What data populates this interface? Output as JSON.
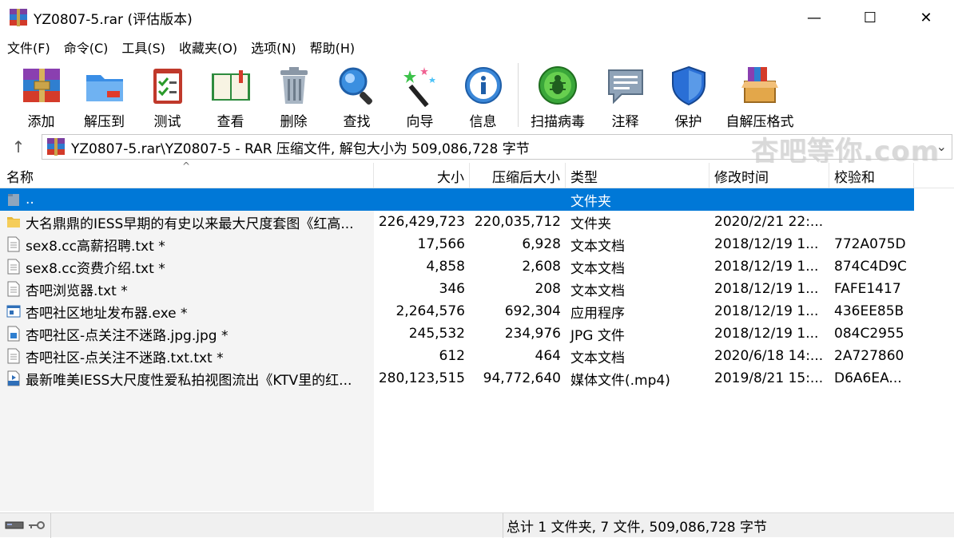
{
  "window": {
    "title": "YZ0807-5.rar (评估版本)",
    "minimize_glyph": "—",
    "maximize_glyph": "☐",
    "close_glyph": "✕"
  },
  "menu": [
    "文件(F)",
    "命令(C)",
    "工具(S)",
    "收藏夹(O)",
    "选项(N)",
    "帮助(H)"
  ],
  "toolbar": {
    "add": "添加",
    "extract_to": "解压到",
    "test": "测试",
    "view": "查看",
    "delete": "删除",
    "find": "查找",
    "wizard": "向导",
    "info": "信息",
    "virus_scan": "扫描病毒",
    "comment": "注释",
    "protect": "保护",
    "sfx": "自解压格式"
  },
  "watermark": "杏吧等你.com",
  "address": {
    "up_glyph": "↑",
    "path": "YZ0807-5.rar\\YZ0807-5 - RAR 压缩文件, 解包大小为 509,086,728 字节",
    "dropdown_glyph": "⌄"
  },
  "columns": {
    "name": "名称",
    "size": "大小",
    "packed": "压缩后大小",
    "type": "类型",
    "modified": "修改时间",
    "crc": "校验和"
  },
  "rows": [
    {
      "icon": "parent-folder-icon",
      "name": "..",
      "size": "",
      "packed": "",
      "type": "文件夹",
      "modified": "",
      "crc": "",
      "selected": true
    },
    {
      "icon": "folder-icon",
      "name": "大名鼎鼎的IESS早期的有史以来最大尺度套图《红高...",
      "size": "226,429,723",
      "packed": "220,035,712",
      "type": "文件夹",
      "modified": "2020/2/21 22:...",
      "crc": ""
    },
    {
      "icon": "text-file-icon",
      "name": "sex8.cc高薪招聘.txt *",
      "size": "17,566",
      "packed": "6,928",
      "type": "文本文档",
      "modified": "2018/12/19 1...",
      "crc": "772A075D"
    },
    {
      "icon": "text-file-icon",
      "name": "sex8.cc资费介绍.txt *",
      "size": "4,858",
      "packed": "2,608",
      "type": "文本文档",
      "modified": "2018/12/19 1...",
      "crc": "874C4D9C"
    },
    {
      "icon": "text-file-icon",
      "name": "杏吧浏览器.txt *",
      "size": "346",
      "packed": "208",
      "type": "文本文档",
      "modified": "2018/12/19 1...",
      "crc": "FAFE1417"
    },
    {
      "icon": "exe-file-icon",
      "name": "杏吧社区地址发布器.exe *",
      "size": "2,264,576",
      "packed": "692,304",
      "type": "应用程序",
      "modified": "2018/12/19 1...",
      "crc": "436EE85B"
    },
    {
      "icon": "image-file-icon",
      "name": "杏吧社区-点关注不迷路.jpg.jpg *",
      "size": "245,532",
      "packed": "234,976",
      "type": "JPG 文件",
      "modified": "2018/12/19 1...",
      "crc": "084C2955"
    },
    {
      "icon": "text-file-icon",
      "name": "杏吧社区-点关注不迷路.txt.txt *",
      "size": "612",
      "packed": "464",
      "type": "文本文档",
      "modified": "2020/6/18 14:...",
      "crc": "2A727860"
    },
    {
      "icon": "mp4-file-icon",
      "name": "最新唯美IESS大尺度性爱私拍视图流出《KTV里的红...",
      "size": "280,123,515",
      "packed": "94,772,640",
      "type": "媒体文件(.mp4)",
      "modified": "2019/8/21 15:...",
      "crc": "D6A6EA..."
    }
  ],
  "status": {
    "summary": "总计 1 文件夹, 7 文件, 509,086,728 字节"
  },
  "colors": {
    "selection": "#0078d7",
    "name_column_bg": "#f4f4f4"
  }
}
